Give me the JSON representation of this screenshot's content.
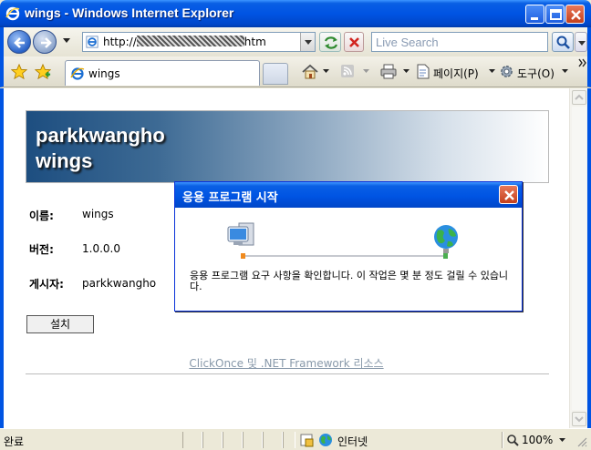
{
  "window": {
    "title": "wings - Windows Internet Explorer"
  },
  "address": {
    "url_prefix": "http://",
    "url_suffix": "htm"
  },
  "search": {
    "placeholder": "Live Search"
  },
  "tab": {
    "label": "wings"
  },
  "commands": {
    "page_label": "페이지(P)",
    "tools_label": "도구(O)"
  },
  "page": {
    "banner_line1": "parkkwangho",
    "banner_line2": "wings",
    "fields": [
      {
        "label": "이름:",
        "value": "wings"
      },
      {
        "label": "버전:",
        "value": "1.0.0.0"
      },
      {
        "label": "게시자:",
        "value": "parkkwangho"
      }
    ],
    "install_label": "설치",
    "footer_link": "ClickOnce 및 .NET Framework 리소스"
  },
  "dialog": {
    "title": "응용 프로그램 시작",
    "message": "응용 프로그램 요구 사항을 확인합니다. 이 작업은 몇 분 정도 걸릴 수 있습니다."
  },
  "status": {
    "text": "완료",
    "zone": "인터넷",
    "zoom": "100%"
  },
  "colors": {
    "xp_blue": "#0054e3",
    "banner_dark": "#1d4e80"
  }
}
